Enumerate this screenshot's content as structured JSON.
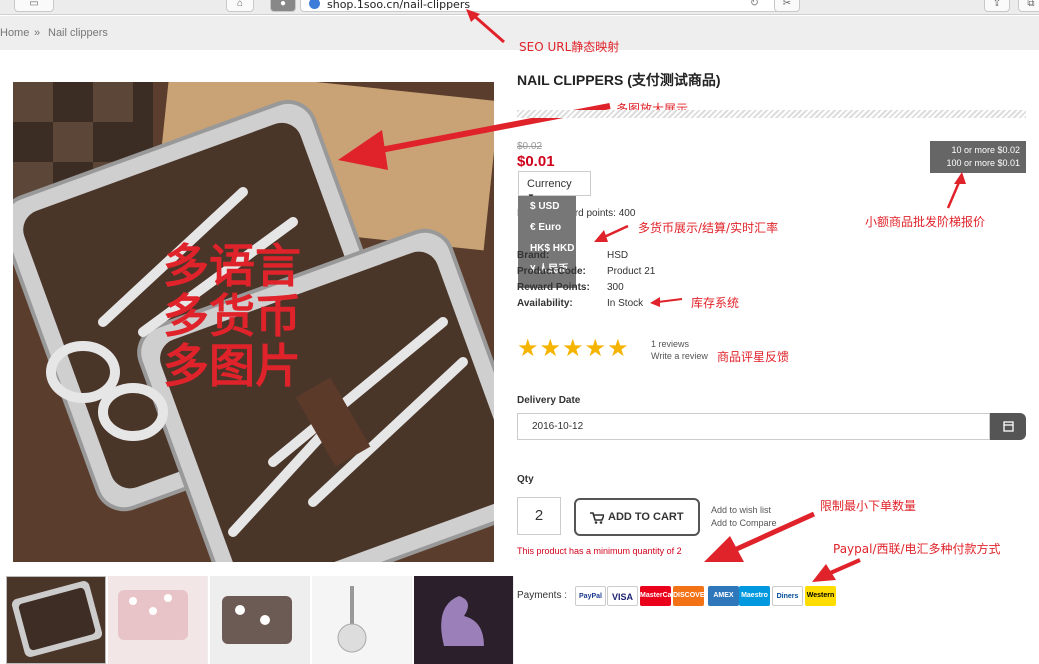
{
  "browser": {
    "url": "shop.1soo.cn/nail-clippers"
  },
  "breadcrumb": {
    "home": "Home",
    "sep": "»",
    "current": "Nail clippers"
  },
  "product": {
    "title": "NAIL CLIPPERS (支付测试商品)",
    "old_price": "$0.02",
    "price": "$0.01",
    "tiers": [
      "10 or more $0.02",
      "100 or more $0.01"
    ],
    "currency_label": "Currency",
    "currencies": [
      "$ USD",
      "€ Euro",
      "HK$ HKD",
      "¥ 人民币"
    ],
    "reward_points_text": "Price in reward points: 400",
    "brand_label": "Brand:",
    "brand_value": "HSD",
    "code_label": "Product Code:",
    "code_value": "Product 21",
    "reward_label": "Reward Points:",
    "reward_value": "300",
    "availability_label": "Availability:",
    "availability_value": "In Stock",
    "rating": 5,
    "reviews_text": "1 reviews",
    "write_review": "Write a review",
    "delivery_label": "Delivery Date",
    "delivery_value": "2016-10-12",
    "qty_label": "Qty",
    "qty_value": "2",
    "add_to_cart": "ADD TO CART",
    "wish_list": "Add to wish list",
    "compare": "Add to Compare",
    "min_qty_msg": "This product has a minimum quantity of 2",
    "payments_label": "Payments :",
    "payment_methods": [
      "PayPal",
      "VISA",
      "MasterCard",
      "DISCOVER",
      "AMEX",
      "Maestro",
      "Diners",
      "Western Union"
    ]
  },
  "overlay_text": {
    "line1": "多语言",
    "line2": "多货币",
    "line3": "多图片"
  },
  "annotations": {
    "seo": "SEO URL静态映射",
    "images": "多图放大展示",
    "currency": "多货币展示/结算/实时汇率",
    "tier": "小额商品批发阶梯报价",
    "stock": "库存系统",
    "rating": "商品评星反馈",
    "minqty": "限制最小下单数量",
    "payment": "Paypal/西联/电汇多种付款方式"
  },
  "colors": {
    "annotation": "#e0232a",
    "price": "#d0021b",
    "star": "#f5b400",
    "panel": "#666666"
  }
}
